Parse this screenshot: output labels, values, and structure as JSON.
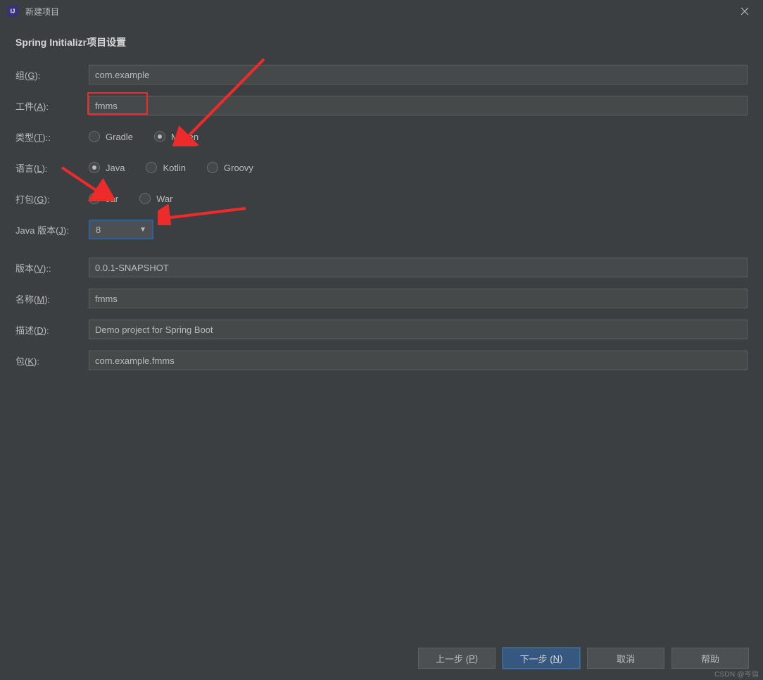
{
  "window": {
    "title": "新建项目"
  },
  "section_title": "Spring Initializr项目设置",
  "labels": {
    "group": {
      "pre": "组(",
      "u": "G",
      "post": "):"
    },
    "artifact": {
      "pre": "工件(",
      "u": "A",
      "post": "):"
    },
    "type": {
      "pre": "类型(",
      "u": "T",
      "post": ")::"
    },
    "language": {
      "pre": "语言(",
      "u": "L",
      "post": "):"
    },
    "packaging": {
      "pre": "打包(",
      "u": "G",
      "post": "):"
    },
    "java_version": {
      "pre": "Java 版本(",
      "u": "J",
      "post": "):"
    },
    "version": {
      "pre": "版本(",
      "u": "V",
      "post": ")::"
    },
    "name": {
      "pre": "名称(",
      "u": "M",
      "post": "):"
    },
    "description": {
      "pre": "描述(",
      "u": "D",
      "post": "):"
    },
    "package": {
      "pre": "包(",
      "u": "K",
      "post": "):"
    }
  },
  "fields": {
    "group": "com.example",
    "artifact": "fmms",
    "type_options": {
      "gradle": "Gradle",
      "maven": "Maven"
    },
    "type_selected": "maven",
    "language_options": {
      "java": "Java",
      "kotlin": "Kotlin",
      "groovy": "Groovy"
    },
    "language_selected": "java",
    "packaging_options": {
      "jar": "Jar",
      "war": "War"
    },
    "packaging_selected": "jar",
    "java_version": "8",
    "version": "0.0.1-SNAPSHOT",
    "name": "fmms",
    "description": "Demo project for Spring Boot",
    "package": "com.example.fmms"
  },
  "buttons": {
    "previous": {
      "pre": "上一步 (",
      "u": "P",
      "post": ")"
    },
    "next": {
      "pre": "下一步 (",
      "u": "N",
      "post": ")"
    },
    "cancel": "取消",
    "help": "帮助"
  },
  "watermark": "CSDN @岑诣"
}
